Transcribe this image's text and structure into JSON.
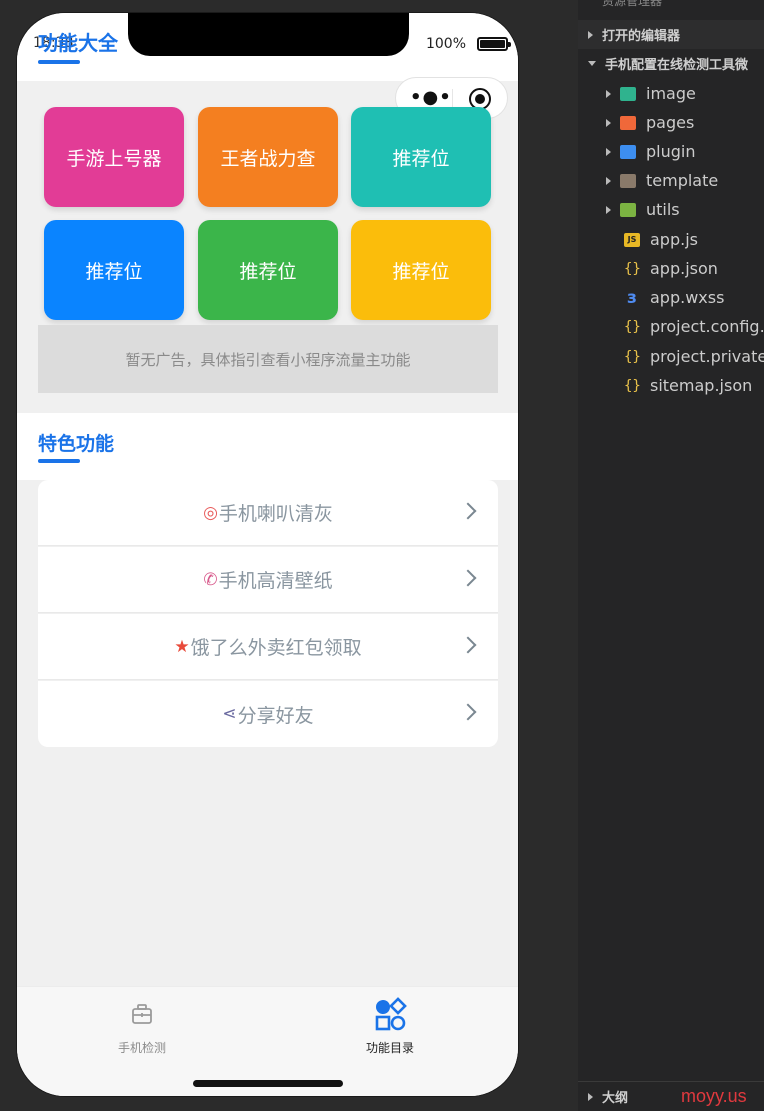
{
  "status": {
    "time": "18:38",
    "battery": "100%"
  },
  "header": {
    "title": "功能大全"
  },
  "grid": {
    "tiles": [
      {
        "label": "手游上号器",
        "color": "#e23c96"
      },
      {
        "label": "王者战力查",
        "color": "#f47f20"
      },
      {
        "label": "推荐位",
        "color": "#1fbfb3"
      },
      {
        "label": "推荐位",
        "color": "#0a84ff"
      },
      {
        "label": "推荐位",
        "color": "#3bb54a"
      },
      {
        "label": "推荐位",
        "color": "#fbbd0b"
      }
    ]
  },
  "ad": {
    "text": "暂无广告，具体指引查看小程序流量主功能"
  },
  "section": {
    "title": "特色功能"
  },
  "list": {
    "items": [
      {
        "icon": "camera-icon",
        "glyph": "◎",
        "label": "手机喇叭清灰",
        "icon_color": "#e85a5a"
      },
      {
        "icon": "phone-icon",
        "glyph": "✆",
        "label": "手机高清壁纸",
        "icon_color": "#d85a8c"
      },
      {
        "icon": "star-icon",
        "glyph": "★",
        "label": "饿了么外卖红包领取",
        "icon_color": "#e84a3a"
      },
      {
        "icon": "share-icon",
        "glyph": "⋖",
        "label": "分享好友",
        "icon_color": "#6a6aa0"
      }
    ]
  },
  "tabbar": {
    "tabs": [
      {
        "label": "手机检测",
        "icon": "briefcase-icon",
        "active": false
      },
      {
        "label": "功能目录",
        "icon": "apps-icon",
        "active": true
      }
    ]
  },
  "ide": {
    "top_label": "资源管理器",
    "open_editors": "打开的编辑器",
    "project": "手机配置在线检测工具微",
    "tree": [
      {
        "name": "image",
        "type": "folder",
        "color": "#2fb38e"
      },
      {
        "name": "pages",
        "type": "folder",
        "color": "#f0683a"
      },
      {
        "name": "plugin",
        "type": "folder",
        "color": "#3d8ef0"
      },
      {
        "name": "template",
        "type": "folder",
        "color": "#8a7a6a"
      },
      {
        "name": "utils",
        "type": "folder",
        "color": "#7cb342"
      },
      {
        "name": "app.js",
        "type": "js"
      },
      {
        "name": "app.json",
        "type": "json"
      },
      {
        "name": "app.wxss",
        "type": "wxss"
      },
      {
        "name": "project.config.j",
        "type": "json"
      },
      {
        "name": "project.private.",
        "type": "json"
      },
      {
        "name": "sitemap.json",
        "type": "json"
      }
    ],
    "outline": "大纲"
  },
  "watermark": "moyy.us"
}
